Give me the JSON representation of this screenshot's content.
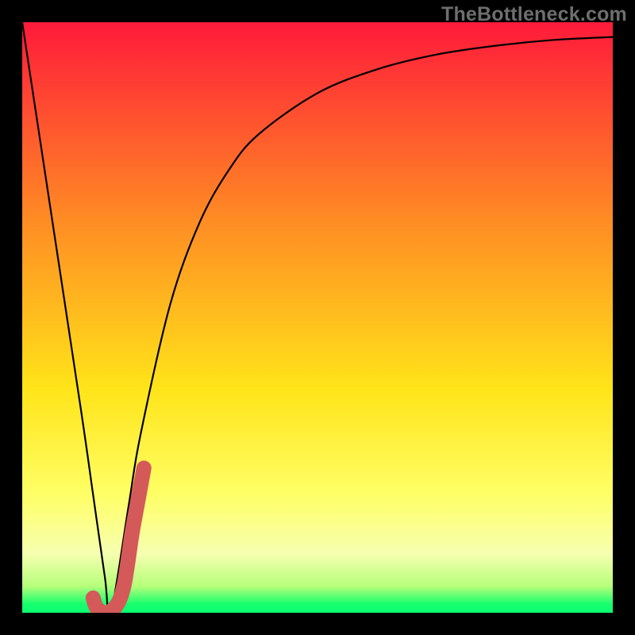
{
  "watermark": "TheBottleneck.com",
  "chart_data": {
    "type": "line",
    "xlabel": "",
    "ylabel": "",
    "xlim": [
      0,
      100
    ],
    "ylim": [
      0,
      100
    ],
    "grid": false,
    "title": "",
    "series": [
      {
        "name": "bottleneck-curve",
        "x": [
          0,
          5,
          10,
          12,
          14,
          15,
          18,
          20,
          25,
          30,
          35,
          40,
          50,
          60,
          70,
          80,
          90,
          100
        ],
        "y": [
          100,
          67,
          34,
          20,
          6,
          0,
          18,
          30,
          52,
          66,
          75,
          81,
          88,
          92,
          94.5,
          96,
          97,
          97.5
        ]
      }
    ],
    "highlight_segment": {
      "name": "j-stroke",
      "x": [
        12.0,
        12.5,
        13.2,
        14.2,
        15.4,
        16.4,
        17.2,
        17.8,
        18.6,
        19.6,
        20.6
      ],
      "y": [
        2.5,
        1.0,
        0.3,
        0.0,
        0.6,
        2.0,
        4.5,
        8.0,
        13.5,
        19.0,
        24.5
      ]
    },
    "gradient_stops": [
      {
        "offset": 0.0,
        "color": "#ff1a3a"
      },
      {
        "offset": 0.33,
        "color": "#ff8a24"
      },
      {
        "offset": 0.62,
        "color": "#ffe419"
      },
      {
        "offset": 0.8,
        "color": "#ffff66"
      },
      {
        "offset": 0.9,
        "color": "#f6ffb0"
      },
      {
        "offset": 0.955,
        "color": "#b6ff7a"
      },
      {
        "offset": 0.985,
        "color": "#17ff6e"
      },
      {
        "offset": 1.0,
        "color": "#0bff6f"
      }
    ],
    "curve_color": "#000000",
    "highlight_color": "#d45a5a"
  }
}
